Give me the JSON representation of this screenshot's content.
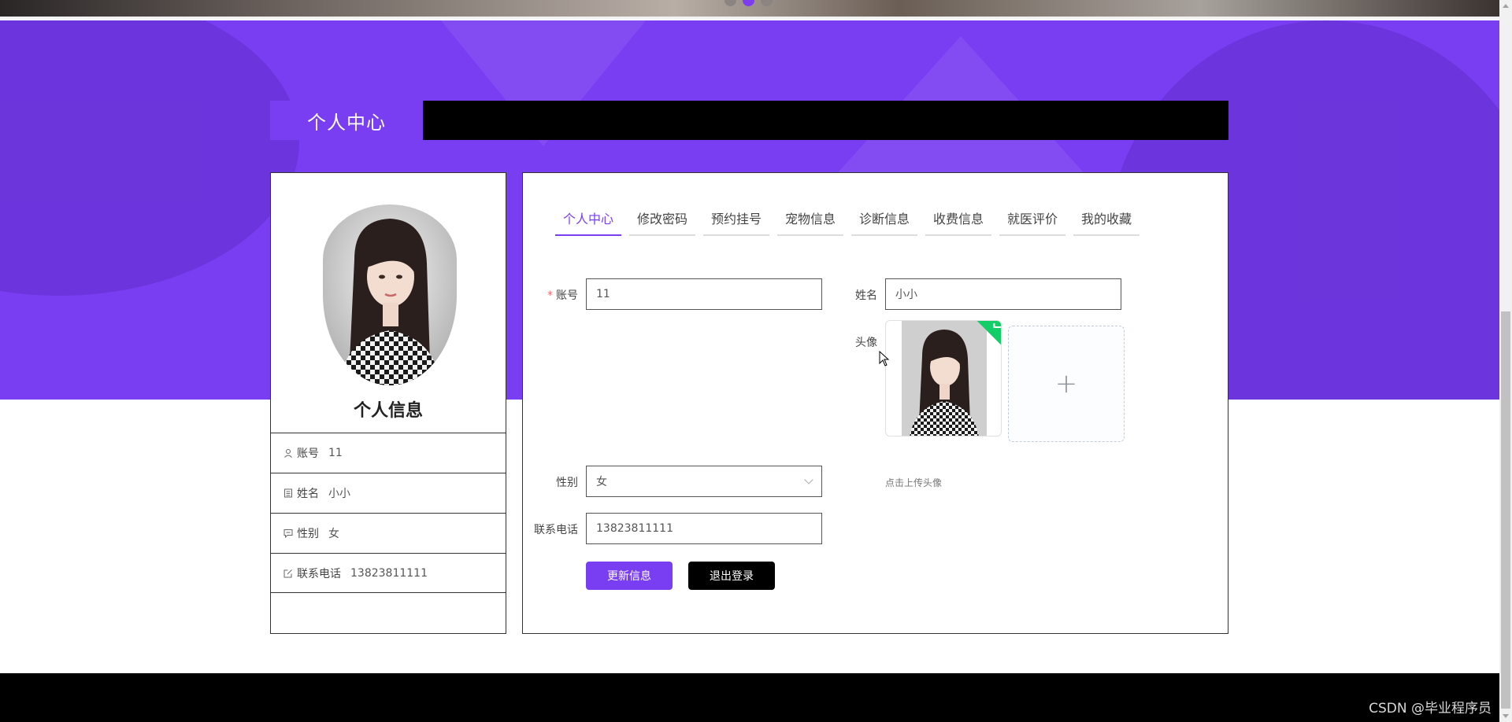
{
  "section": {
    "title": "个人中心"
  },
  "profile": {
    "heading": "个人信息",
    "rows": [
      {
        "icon": "user-icon",
        "label": "账号",
        "value": "11"
      },
      {
        "icon": "id-card-icon",
        "label": "姓名",
        "value": "小小"
      },
      {
        "icon": "chat-icon",
        "label": "性别",
        "value": "女"
      },
      {
        "icon": "edit-icon",
        "label": "联系电话",
        "value": "13823811111"
      }
    ]
  },
  "tabs": [
    {
      "label": "个人中心",
      "active": true
    },
    {
      "label": "修改密码",
      "active": false
    },
    {
      "label": "预约挂号",
      "active": false
    },
    {
      "label": "宠物信息",
      "active": false
    },
    {
      "label": "诊断信息",
      "active": false
    },
    {
      "label": "收费信息",
      "active": false
    },
    {
      "label": "就医评价",
      "active": false
    },
    {
      "label": "我的收藏",
      "active": false
    }
  ],
  "form": {
    "account": {
      "label": "账号",
      "required_mark": "*",
      "value": "11"
    },
    "name": {
      "label": "姓名",
      "value": "小小"
    },
    "avatar": {
      "label": "头像",
      "add_symbol": "+",
      "tip": "点击上传头像"
    },
    "gender": {
      "label": "性别",
      "value": "女"
    },
    "phone": {
      "label": "联系电话",
      "value": "13823811111"
    }
  },
  "buttons": {
    "update": "更新信息",
    "logout": "退出登录"
  },
  "watermark": "CSDN @毕业程序员",
  "colors": {
    "accent": "#7a3ef2",
    "dark": "#000000",
    "success": "#13ce66"
  }
}
